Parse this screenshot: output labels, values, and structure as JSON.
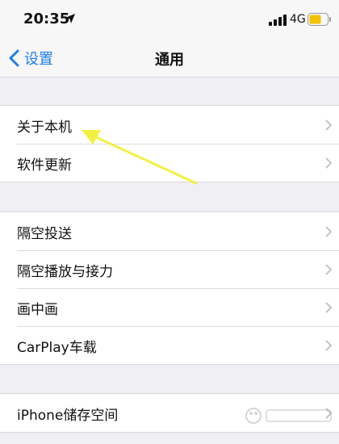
{
  "status_bar": {
    "time": "20:35",
    "network": "4G"
  },
  "nav": {
    "back_label": "设置",
    "title": "通用"
  },
  "groups": [
    {
      "items": [
        {
          "label": "关于本机"
        },
        {
          "label": "软件更新"
        }
      ]
    },
    {
      "items": [
        {
          "label": "隔空投送"
        },
        {
          "label": "隔空播放与接力"
        },
        {
          "label": "画中画"
        },
        {
          "label": "CarPlay车载"
        }
      ]
    },
    {
      "items": [
        {
          "label": "iPhone储存空间"
        }
      ]
    }
  ],
  "colors": {
    "accent": "#1f7cf0",
    "annotation_arrow": "#f2f040",
    "background": "#efeff4"
  },
  "icons": {
    "location": "location-arrow-icon",
    "signal": "cellular-signal-icon",
    "battery": "battery-icon",
    "back": "chevron-left-icon",
    "row": "chevron-right-icon"
  }
}
